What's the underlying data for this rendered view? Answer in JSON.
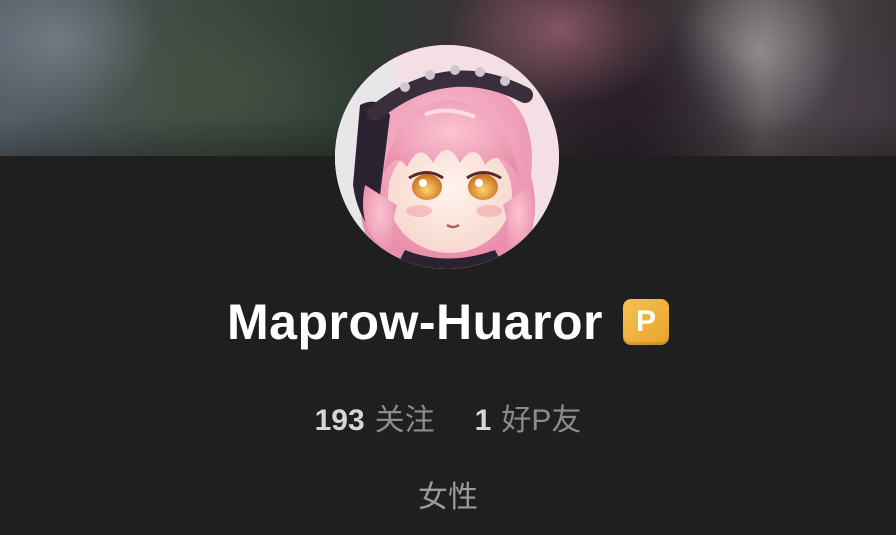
{
  "profile": {
    "username": "Maprow-Huaror",
    "badge_label": "P",
    "badge_color": "#f3b23f",
    "avatar_icon": "anime-girl-avatar",
    "stats": [
      {
        "value": "193",
        "label": "关注"
      },
      {
        "value": "1",
        "label": "好P友"
      }
    ],
    "gender": "女性"
  },
  "colors": {
    "background": "#1f1f1f",
    "username": "#ffffff",
    "stat_number": "#d6d6d6",
    "stat_label": "#8c8c8c"
  }
}
